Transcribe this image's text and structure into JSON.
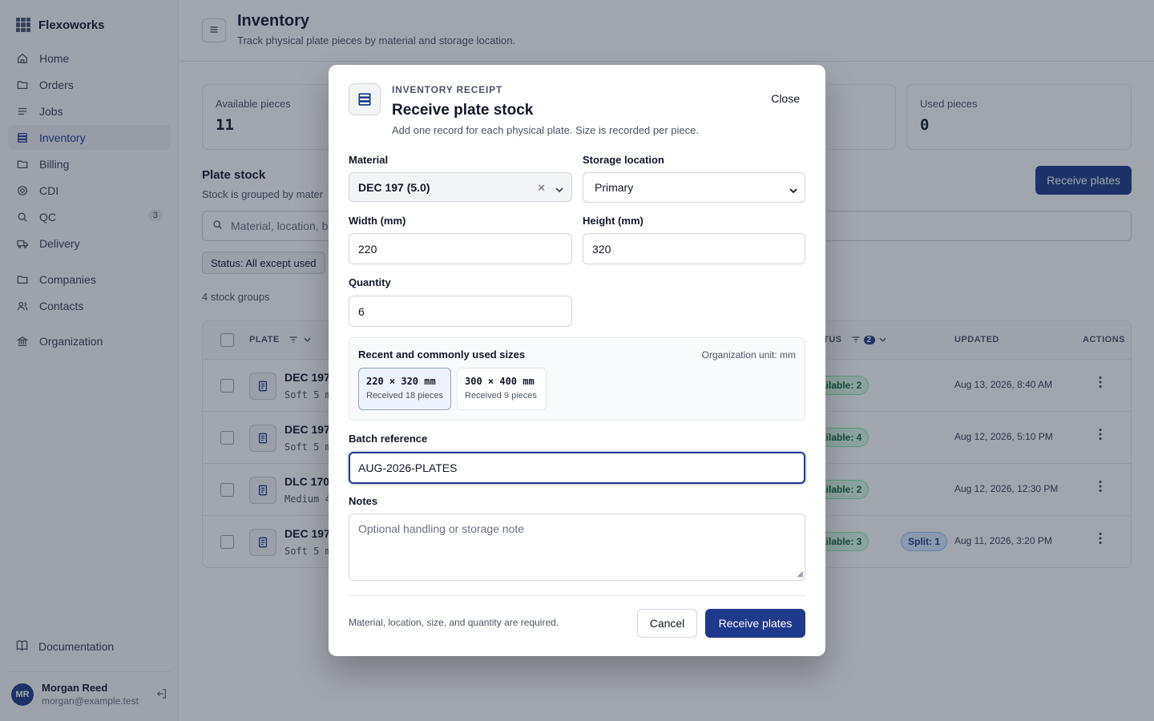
{
  "app": {
    "name": "Flexoworks"
  },
  "sidebar": {
    "items": [
      {
        "label": "Home",
        "icon": "home-icon"
      },
      {
        "label": "Orders",
        "icon": "folder-icon"
      },
      {
        "label": "Jobs",
        "icon": "list-icon"
      },
      {
        "label": "Inventory",
        "icon": "layers-icon"
      },
      {
        "label": "Billing",
        "icon": "folder-icon"
      },
      {
        "label": "CDI",
        "icon": "target-icon"
      },
      {
        "label": "QC",
        "icon": "search-icon",
        "badge": "3"
      },
      {
        "label": "Delivery",
        "icon": "truck-icon"
      },
      {
        "label": "Companies",
        "icon": "building-icon"
      },
      {
        "label": "Contacts",
        "icon": "users-icon"
      },
      {
        "label": "Organization",
        "icon": "bank-icon"
      }
    ],
    "documentation": "Documentation",
    "user": {
      "initials": "MR",
      "name": "Morgan Reed",
      "email": "morgan@example.test"
    }
  },
  "header": {
    "title": "Inventory",
    "subtitle": "Track physical plate pieces by material and storage location."
  },
  "stats": [
    {
      "label": "Available pieces",
      "value": "11"
    },
    {
      "label": "Used pieces",
      "value": "0"
    }
  ],
  "stock": {
    "title": "Plate stock",
    "subtitle": "Stock is grouped by mater",
    "receive_label": "Receive plates",
    "search_placeholder": "Material, location, b",
    "status_chip": "Status: All except used",
    "group_count": "4 stock groups",
    "columns": {
      "plate": "PLATE",
      "status": "TUS",
      "status_count": "2",
      "updated": "UPDATED",
      "actions": "ACTIONS"
    },
    "rows": [
      {
        "name": "DEC 197",
        "sub": "Soft 5 m",
        "pills": [
          "ailable: 2"
        ],
        "updated": "Aug 13, 2026, 8:40 AM"
      },
      {
        "name": "DEC 197",
        "sub": "Soft 5 m",
        "pills": [
          "ailable: 4"
        ],
        "updated": "Aug 12, 2026, 5:10 PM"
      },
      {
        "name": "DLC 170",
        "sub": "Medium 4",
        "pills": [
          "ailable: 2"
        ],
        "updated": "Aug 12, 2026, 12:30 PM"
      },
      {
        "name": "DEC 197",
        "sub": "Soft 5 m",
        "pills": [
          "ailable: 3",
          "Split: 1"
        ],
        "updated": "Aug 11, 2026, 3:20 PM"
      }
    ]
  },
  "modal": {
    "eyebrow": "INVENTORY RECEIPT",
    "title": "Receive plate stock",
    "description": "Add one record for each physical plate. Size is recorded per piece.",
    "close_label": "Close",
    "material": {
      "label": "Material",
      "value": "DEC 197 (5.0)"
    },
    "location": {
      "label": "Storage location",
      "value": "Primary"
    },
    "width": {
      "label": "Width (mm)",
      "value": "220"
    },
    "height": {
      "label": "Height (mm)",
      "value": "320"
    },
    "quantity": {
      "label": "Quantity",
      "value": "6"
    },
    "sizes": {
      "title": "Recent and commonly used sizes",
      "unit": "Organization unit: mm",
      "options": [
        {
          "dim": "220 × 320 mm",
          "note": "Received 18 pieces",
          "selected": true
        },
        {
          "dim": "300 × 400 mm",
          "note": "Received 9 pieces",
          "selected": false
        }
      ]
    },
    "batch": {
      "label": "Batch reference",
      "value": "AUG-2026-PLATES"
    },
    "notes": {
      "label": "Notes",
      "placeholder": "Optional handling or storage note"
    },
    "footer_note": "Material, location, size, and quantity are required.",
    "cancel_label": "Cancel",
    "submit_label": "Receive plates"
  },
  "colors": {
    "accent": "#1e3a8a",
    "overlay": "#1e293b",
    "available": "#dcfce7",
    "split": "#dbeafe"
  }
}
